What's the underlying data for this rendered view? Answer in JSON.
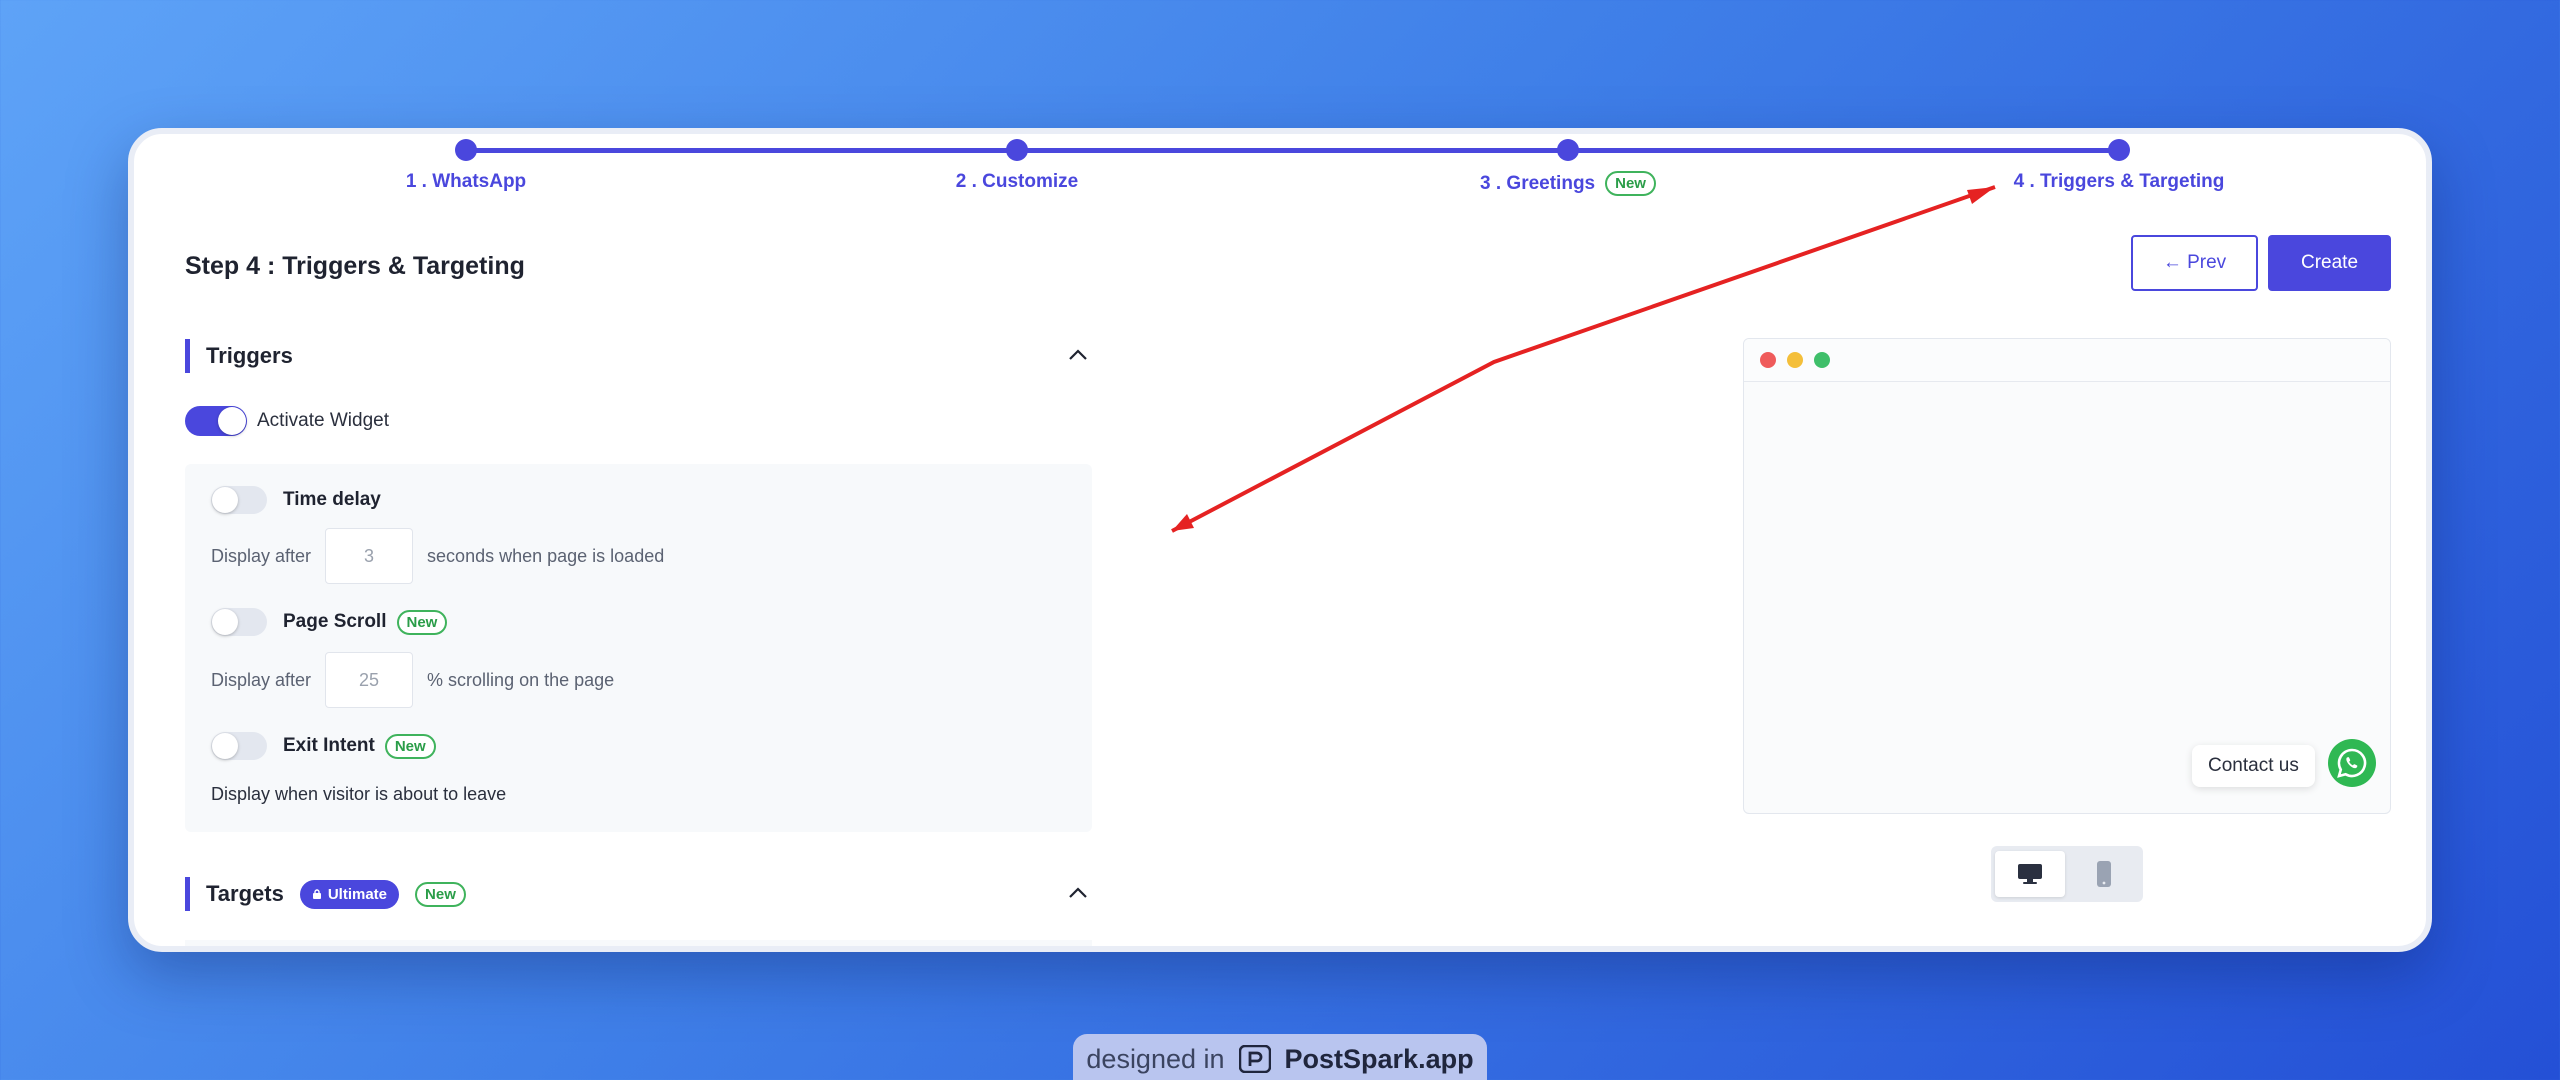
{
  "stepper": {
    "steps": [
      {
        "label": "1 . WhatsApp"
      },
      {
        "label": "2 . Customize"
      },
      {
        "label": "3 . Greetings",
        "badge": "New"
      },
      {
        "label": "4 . Triggers & Targeting"
      }
    ]
  },
  "header": {
    "title": "Step 4 : Triggers & Targeting",
    "prev_label": "← Prev",
    "create_label": "Create"
  },
  "triggers": {
    "title": "Triggers",
    "activate_label": "Activate Widget",
    "activate_on": true,
    "time_delay": {
      "name": "Time delay",
      "prefix": "Display after",
      "value": "3",
      "suffix": "seconds when page is loaded"
    },
    "page_scroll": {
      "name": "Page Scroll",
      "badge": "New",
      "prefix": "Display after",
      "value": "25",
      "suffix": "% scrolling on the page"
    },
    "exit_intent": {
      "name": "Exit Intent",
      "badge": "New",
      "description": "Display when visitor is about to leave"
    }
  },
  "targets": {
    "title": "Targets",
    "ultimate_badge": "Ultimate",
    "new_badge": "New"
  },
  "preview": {
    "contact_label": "Contact us",
    "dot_colors": [
      "#ef5b5b",
      "#f4bf3a",
      "#3fbf6a"
    ],
    "whatsapp_color": "#2fb853"
  },
  "footer": {
    "prefix": "designed in",
    "brand": "PostSpark.app"
  },
  "colors": {
    "accent": "#4a47dd",
    "new_badge": "#3fb35c",
    "annotation_arrow": "#e52222"
  }
}
